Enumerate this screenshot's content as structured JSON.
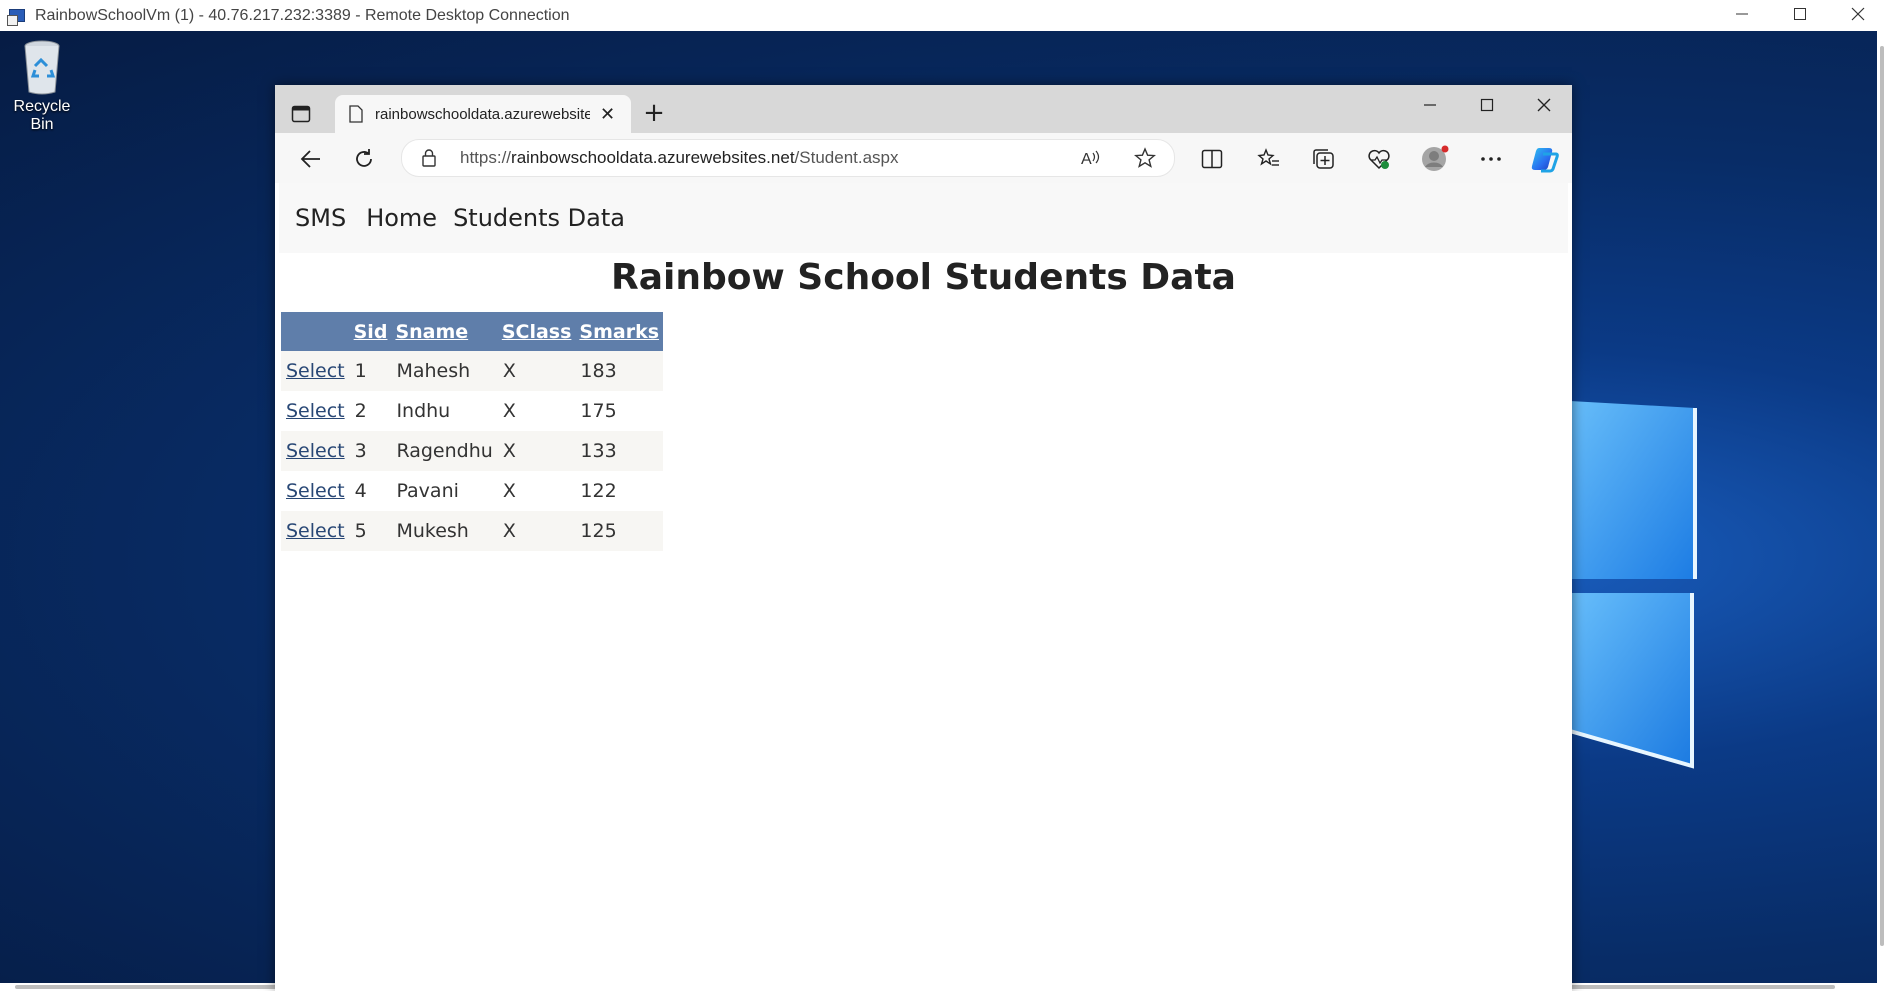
{
  "rdp": {
    "title": "RainbowSchoolVm (1) - 40.76.217.232:3389 - Remote Desktop Connection",
    "minimize": "—",
    "maximize": "☐",
    "close": "✕"
  },
  "desktop": {
    "recycle_bin_label": "Recycle Bin"
  },
  "browser": {
    "tab_title": "rainbowschooldata.azurewebsites.net",
    "tab_close": "✕",
    "new_tab": "+",
    "url_scheme": "https://",
    "url_host": "rainbowschooldata.azurewebsites.net",
    "url_path": "/Student.aspx"
  },
  "page": {
    "nav": {
      "brand": "SMS",
      "home": "Home",
      "students_data": "Students Data"
    },
    "heading": "Rainbow School Students Data",
    "table": {
      "headers": [
        "",
        "Sid",
        "Sname",
        "SClass",
        "Smarks"
      ],
      "select_label": "Select",
      "rows": [
        {
          "sid": "1",
          "sname": "Mahesh",
          "sclass": "X",
          "smarks": "183"
        },
        {
          "sid": "2",
          "sname": "Indhu",
          "sclass": "X",
          "smarks": "175"
        },
        {
          "sid": "3",
          "sname": "Ragendhu",
          "sclass": "X",
          "smarks": "133"
        },
        {
          "sid": "4",
          "sname": "Pavani",
          "sclass": "X",
          "smarks": "122"
        },
        {
          "sid": "5",
          "sname": "Mukesh",
          "sclass": "X",
          "smarks": "125"
        }
      ]
    }
  }
}
